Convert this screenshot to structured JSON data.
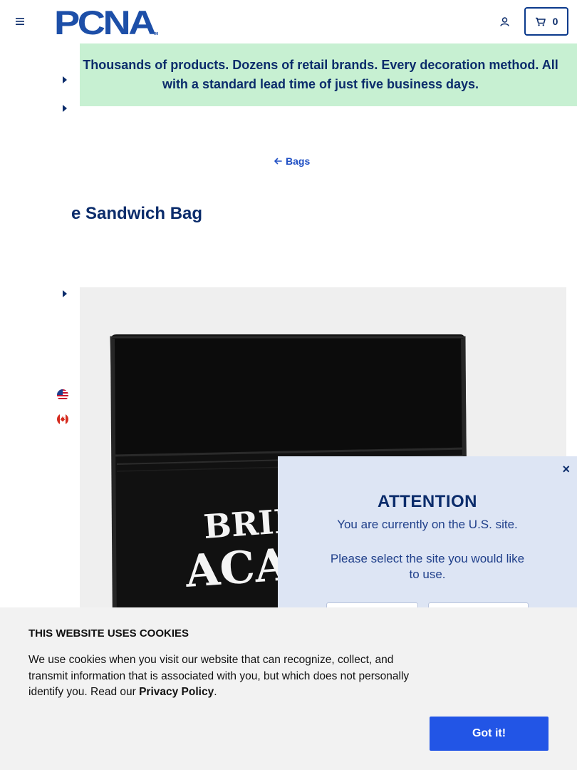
{
  "header": {
    "logo_text": "PCNA",
    "logo_tm": "TM",
    "cart_count": "0"
  },
  "promo": {
    "text": "Thousands of products. Dozens of retail brands. Every decoration method. All with a standard lead time of just five business days."
  },
  "breadcrumb": {
    "back_label": "Bags"
  },
  "product": {
    "title": "e Sandwich Bag",
    "print_line1": "BRID",
    "print_line2": "ACAI"
  },
  "attention": {
    "close_label": "×",
    "title": "ATTENTION",
    "line1": "You are currently on the U.S. site.",
    "line2": "Please select the site you would like to use."
  },
  "cookie": {
    "title": "THIS WEBSITE USES COOKIES",
    "text_before": "We use cookies when you visit our website that can recognize, collect, and transmit information that is associated with you, but which does not personally identify you. Read our ",
    "link_label": "Privacy Policy",
    "text_after": ".",
    "button_label": "Got it!"
  },
  "colors": {
    "brand_navy": "#0b2c6b",
    "logo_blue": "#1d4fa8",
    "promo_bg": "#c7f0d2",
    "link_blue": "#1f4fc4",
    "button_blue": "#2255e6",
    "modal_bg": "#dde5f4"
  },
  "icons": [
    "hamburger-icon",
    "user-icon",
    "cart-icon",
    "arrow-left-icon",
    "caret-right-icon",
    "us-flag-icon",
    "canada-flag-icon",
    "close-icon"
  ]
}
